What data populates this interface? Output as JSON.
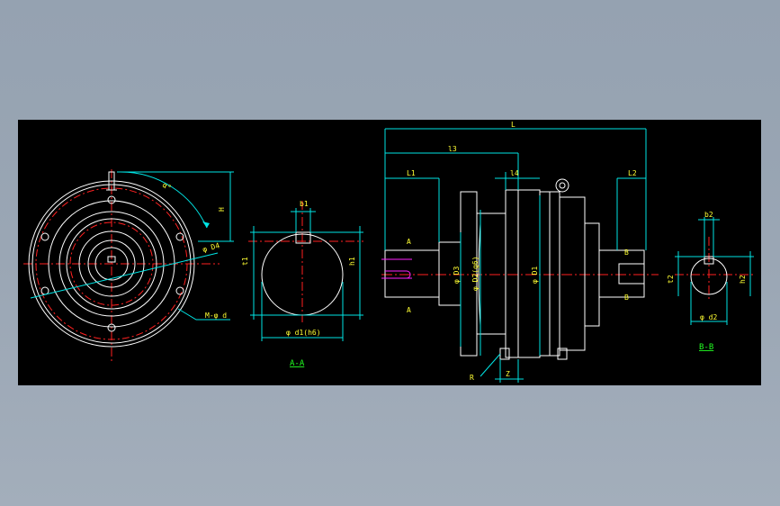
{
  "colors": {
    "outline": "#ffffff",
    "center": "#ff2020",
    "dimension": "#00e5e5",
    "label": "#ffff33",
    "accent": "#ff22ff",
    "caption": "#22ff22"
  },
  "front_view": {
    "angle": "α°",
    "height": "H",
    "bolt_circle": "φ D4",
    "holes": "M-φ d"
  },
  "section_aa": {
    "key_width": "b1",
    "key_depth": "t1",
    "key_height": "h1",
    "diameter": "φ d1(h6)",
    "caption": "A-A"
  },
  "side_view": {
    "overall_length": "L",
    "length_l3": "l3",
    "length_l1": "L1",
    "length_l2": "L2",
    "length_l4": "l4",
    "section_mark_a": "A",
    "section_mark_b": "B",
    "dia_d3": "φ D3",
    "dia_d2": "φ D2(g6)",
    "dia_d1": "φ D1",
    "fillet": "R",
    "thickness": "Z"
  },
  "section_bb": {
    "key_width": "b2",
    "key_depth": "t2",
    "key_height": "h2",
    "diameter": "φ d2",
    "caption": "B-B"
  }
}
